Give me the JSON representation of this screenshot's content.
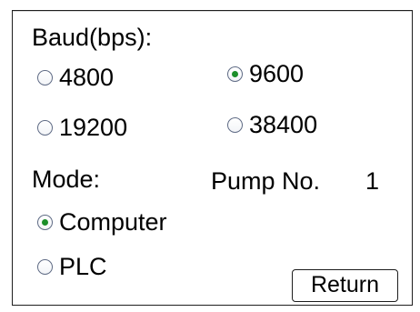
{
  "baud": {
    "label": "Baud(bps):",
    "options": [
      {
        "label": "4800",
        "checked": false
      },
      {
        "label": "9600",
        "checked": true
      },
      {
        "label": "19200",
        "checked": false
      },
      {
        "label": "38400",
        "checked": false
      }
    ]
  },
  "mode": {
    "label": "Mode:",
    "options": [
      {
        "label": "Computer",
        "checked": true
      },
      {
        "label": "PLC",
        "checked": false
      }
    ]
  },
  "pump": {
    "label": "Pump No.",
    "value": "1"
  },
  "actions": {
    "return_label": "Return"
  },
  "colors": {
    "selected_dot": "#1c8e2a",
    "radio_border": "#5f6b85"
  }
}
